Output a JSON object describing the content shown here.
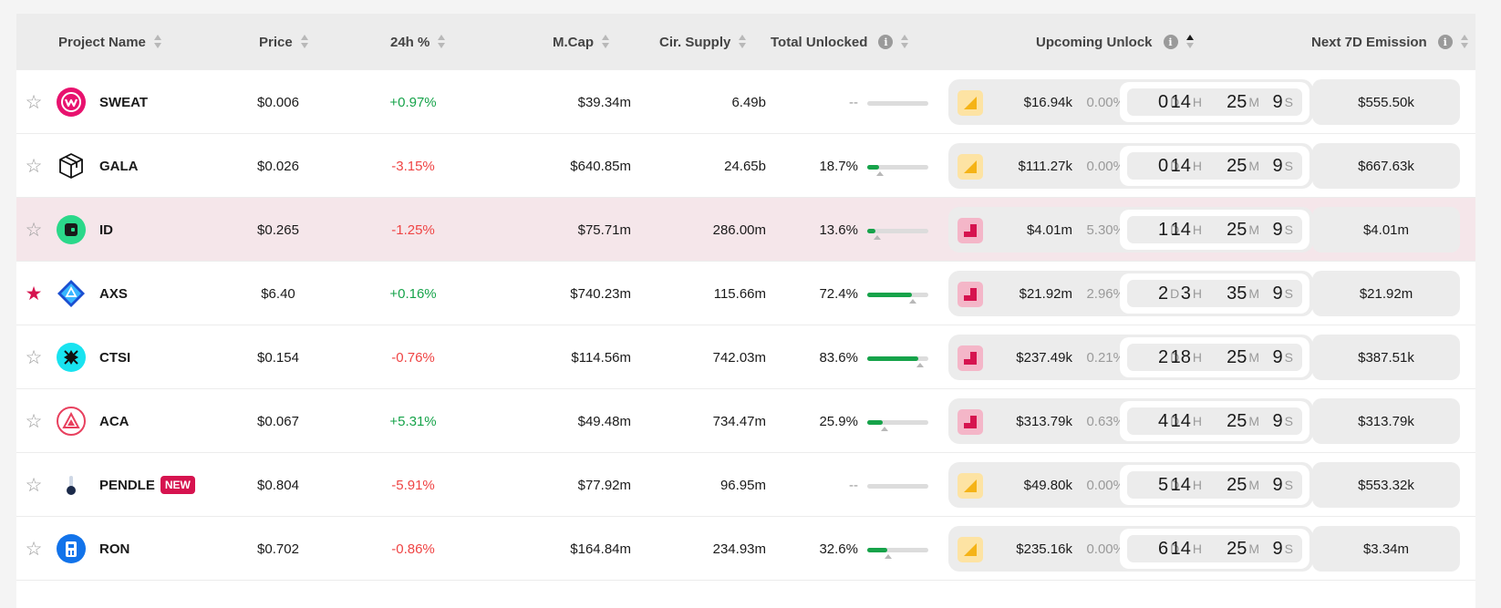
{
  "header": {
    "project_name": "Project Name",
    "price": "Price",
    "change_24h": "24h %",
    "mcap": "M.Cap",
    "supply": "Cir. Supply",
    "total_unlocked": "Total Unlocked",
    "upcoming_unlock": "Upcoming Unlock",
    "emission": "Next 7D Emission",
    "info_glyph": "i"
  },
  "countdown_units": {
    "d": "D",
    "h": "H",
    "m": "M",
    "s": "S"
  },
  "colors": {
    "accent": "#d6134f",
    "positive": "#16a34a",
    "negative": "#ef4444",
    "highlight_row": "#f5e6ea"
  },
  "rows": [
    {
      "starred": false,
      "name": "SWEAT",
      "logo": "sweat-logo",
      "new_badge": "",
      "price": "$0.006",
      "change": "+0.97%",
      "trend": "pos",
      "mcap": "$39.34m",
      "supply": "6.49b",
      "unlocked": "--",
      "unlocked_frac": 0,
      "marker_frac": 0,
      "unlock_type": "linear",
      "unlock_value": "$16.94k",
      "unlock_pct": "0.00%",
      "cd": [
        "0",
        "14",
        "25",
        "9"
      ],
      "emission": "$555.50k"
    },
    {
      "starred": false,
      "name": "GALA",
      "logo": "gala-logo",
      "new_badge": "",
      "price": "$0.026",
      "change": "-3.15%",
      "trend": "neg",
      "mcap": "$640.85m",
      "supply": "24.65b",
      "unlocked": "18.7%",
      "unlocked_frac": 0.187,
      "marker_frac": 0.21,
      "unlock_type": "linear",
      "unlock_value": "$111.27k",
      "unlock_pct": "0.00%",
      "cd": [
        "0",
        "14",
        "25",
        "9"
      ],
      "emission": "$667.63k"
    },
    {
      "starred": false,
      "name": "ID",
      "logo": "id-logo",
      "new_badge": "",
      "price": "$0.265",
      "change": "-1.25%",
      "trend": "neg",
      "mcap": "$75.71m",
      "supply": "286.00m",
      "unlocked": "13.6%",
      "unlocked_frac": 0.136,
      "marker_frac": 0.16,
      "unlock_type": "cliff",
      "unlock_value": "$4.01m",
      "unlock_pct": "5.30%",
      "cd": [
        "1",
        "14",
        "25",
        "9"
      ],
      "emission": "$4.01m",
      "highlight": true
    },
    {
      "starred": true,
      "name": "AXS",
      "logo": "axs-logo",
      "new_badge": "",
      "price": "$6.40",
      "change": "+0.16%",
      "trend": "pos",
      "mcap": "$740.23m",
      "supply": "115.66m",
      "unlocked": "72.4%",
      "unlocked_frac": 0.724,
      "marker_frac": 0.75,
      "unlock_type": "cliff",
      "unlock_value": "$21.92m",
      "unlock_pct": "2.96%",
      "cd": [
        "2",
        "3",
        "35",
        "9"
      ],
      "emission": "$21.92m"
    },
    {
      "starred": false,
      "name": "CTSI",
      "logo": "ctsi-logo",
      "new_badge": "",
      "price": "$0.154",
      "change": "-0.76%",
      "trend": "neg",
      "mcap": "$114.56m",
      "supply": "742.03m",
      "unlocked": "83.6%",
      "unlocked_frac": 0.836,
      "marker_frac": 0.86,
      "unlock_type": "cliff",
      "unlock_value": "$237.49k",
      "unlock_pct": "0.21%",
      "cd": [
        "2",
        "18",
        "25",
        "9"
      ],
      "emission": "$387.51k"
    },
    {
      "starred": false,
      "name": "ACA",
      "logo": "aca-logo",
      "new_badge": "",
      "price": "$0.067",
      "change": "+5.31%",
      "trend": "pos",
      "mcap": "$49.48m",
      "supply": "734.47m",
      "unlocked": "25.9%",
      "unlocked_frac": 0.259,
      "marker_frac": 0.28,
      "unlock_type": "cliff",
      "unlock_value": "$313.79k",
      "unlock_pct": "0.63%",
      "cd": [
        "4",
        "14",
        "25",
        "9"
      ],
      "emission": "$313.79k"
    },
    {
      "starred": false,
      "name": "PENDLE",
      "logo": "pendle-logo",
      "new_badge": "NEW",
      "price": "$0.804",
      "change": "-5.91%",
      "trend": "neg",
      "mcap": "$77.92m",
      "supply": "96.95m",
      "unlocked": "--",
      "unlocked_frac": 0,
      "marker_frac": 0,
      "unlock_type": "linear",
      "unlock_value": "$49.80k",
      "unlock_pct": "0.00%",
      "cd": [
        "5",
        "14",
        "25",
        "9"
      ],
      "emission": "$553.32k"
    },
    {
      "starred": false,
      "name": "RON",
      "logo": "ron-logo",
      "new_badge": "",
      "price": "$0.702",
      "change": "-0.86%",
      "trend": "neg",
      "mcap": "$164.84m",
      "supply": "234.93m",
      "unlocked": "32.6%",
      "unlocked_frac": 0.326,
      "marker_frac": 0.35,
      "unlock_type": "linear",
      "unlock_value": "$235.16k",
      "unlock_pct": "0.00%",
      "cd": [
        "6",
        "14",
        "25",
        "9"
      ],
      "emission": "$3.34m"
    }
  ]
}
